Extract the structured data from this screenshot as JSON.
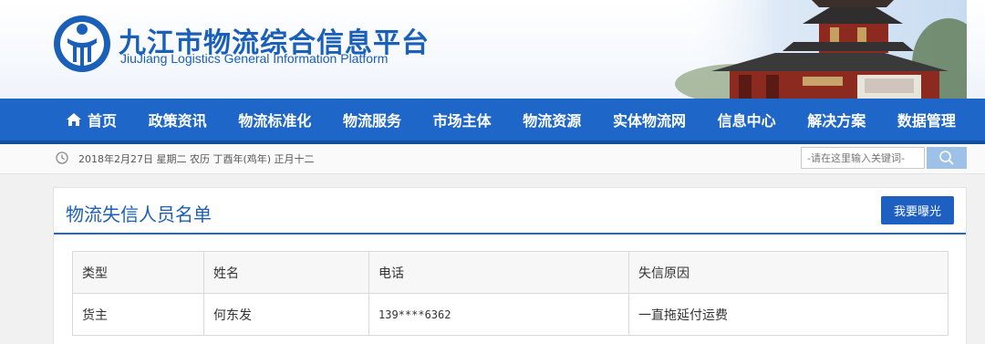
{
  "brand": {
    "name_cn": "九江市物流综合信息平台",
    "name_en": "JiuJiang Logistics General Information Platform"
  },
  "nav": {
    "items": [
      {
        "label": "首页",
        "icon": "home-icon"
      },
      {
        "label": "政策资讯"
      },
      {
        "label": "物流标准化"
      },
      {
        "label": "物流服务"
      },
      {
        "label": "市场主体"
      },
      {
        "label": "物流资源"
      },
      {
        "label": "实体物流网"
      },
      {
        "label": "信息中心"
      },
      {
        "label": "解决方案"
      },
      {
        "label": "数据管理"
      }
    ]
  },
  "datebar": {
    "date_text": "2018年2月27日  星期二  农历  丁酉年(鸡年)  正月十二",
    "clock_icon": "clock-icon"
  },
  "search": {
    "placeholder": "-请在这里输入关键词-",
    "icon": "search-icon"
  },
  "panel": {
    "title": "物流失信人员名单",
    "expose_button": "我要曝光",
    "table": {
      "headers": [
        "类型",
        "姓名",
        "电话",
        "失信原因"
      ],
      "rows": [
        [
          "货主",
          "何东发",
          "139****6362",
          "一直拖延付运费"
        ]
      ]
    }
  },
  "colors": {
    "brand_blue": "#1a5fb8",
    "nav_blue": "#1e67c8",
    "button_blue": "#1e5fc2",
    "search_button": "#9ec1e8"
  }
}
